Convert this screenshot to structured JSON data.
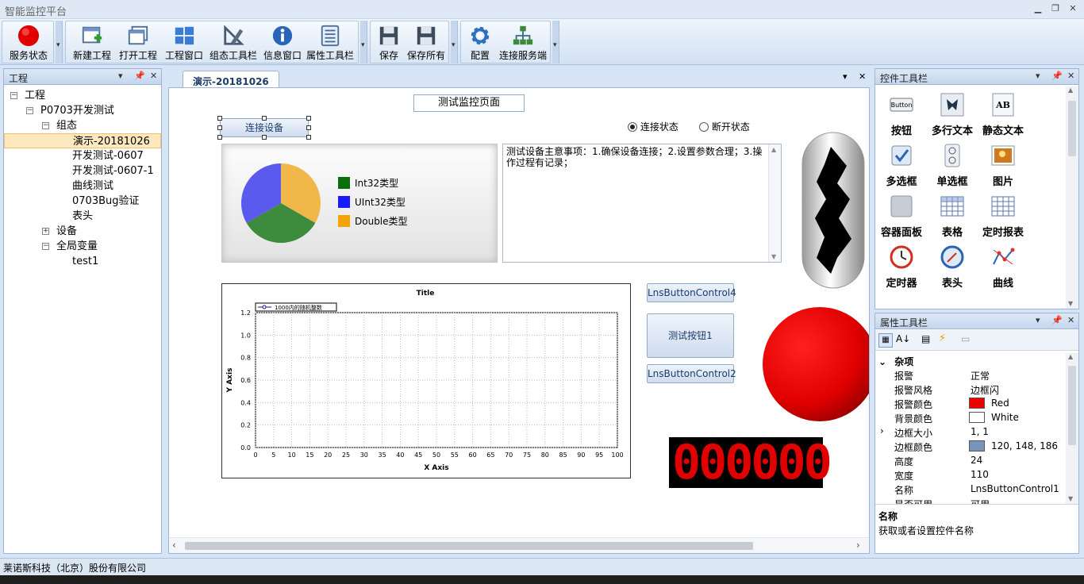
{
  "app": {
    "title": "智能监控平台"
  },
  "toolbar": {
    "g1": [
      "服务状态"
    ],
    "g2": [
      "新建工程",
      "打开工程",
      "工程窗口",
      "组态工具栏",
      "信息窗口",
      "属性工具栏"
    ],
    "g3": [
      "保存",
      "保存所有"
    ],
    "g4": [
      "配置",
      "连接服务端"
    ]
  },
  "project": {
    "title": "工程",
    "tree": [
      {
        "label": "工程",
        "level": 0,
        "tog": "−"
      },
      {
        "label": "P0703开发测试",
        "level": 1,
        "tog": "−"
      },
      {
        "label": "组态",
        "level": 2,
        "tog": "−"
      },
      {
        "label": "演示-20181026",
        "level": 3,
        "selected": true
      },
      {
        "label": "开发测试-0607",
        "level": 3
      },
      {
        "label": "开发测试-0607-1",
        "level": 3
      },
      {
        "label": "曲线测试",
        "level": 3
      },
      {
        "label": "0703Bug验证",
        "level": 3
      },
      {
        "label": "表头",
        "level": 3
      },
      {
        "label": "设备",
        "level": 2,
        "tog": "+"
      },
      {
        "label": "全局变量",
        "level": 2,
        "tog": "−"
      },
      {
        "label": "test1",
        "level": 3
      }
    ]
  },
  "doc": {
    "tab": "演示-20181026",
    "page_title": "测试监控页面",
    "connect_btn": "连接设备",
    "radio_connected": "连接状态",
    "radio_disconnected": "断开状态",
    "notes": "测试设备主意事项：1.确保设备连接；2.设置参数合理；3.操作过程有记录；",
    "pie_legend": [
      {
        "label": "Int32类型",
        "color": "#0a6e0a"
      },
      {
        "label": "UInt32类型",
        "color": "#1a1aff"
      },
      {
        "label": "Double类型",
        "color": "#f4a300"
      }
    ],
    "btn_ctrl4": "LnsButtonControl4",
    "btn_test1": "测试按钮1",
    "btn_ctrl2": "LnsButtonControl2",
    "digits": "000000"
  },
  "chart_data": {
    "type": "line",
    "title": "Title",
    "xlabel": "X Axis",
    "ylabel": "Y Axis",
    "xlim": [
      0,
      100
    ],
    "ylim": [
      0.0,
      1.2
    ],
    "xticks": [
      "0",
      "5",
      "10",
      "15",
      "20",
      "25",
      "30",
      "35",
      "40",
      "45",
      "50",
      "55",
      "60",
      "65",
      "70",
      "75",
      "80",
      "85",
      "90",
      "95",
      "100"
    ],
    "yticks": [
      "0.0",
      "0.2",
      "0.4",
      "0.6",
      "0.8",
      "1.0",
      "1.2"
    ],
    "series": [
      {
        "name": "1000内的随机整数",
        "values": []
      }
    ],
    "grid": true,
    "legend": "top-left"
  },
  "palette": {
    "title": "控件工具栏",
    "items": [
      {
        "label": "按钮",
        "icon": "button-icon"
      },
      {
        "label": "多行文本",
        "icon": "multiline-text-icon"
      },
      {
        "label": "静态文本",
        "icon": "static-text-icon"
      },
      {
        "label": "多选框",
        "icon": "checkbox-icon"
      },
      {
        "label": "单选框",
        "icon": "radio-icon"
      },
      {
        "label": "图片",
        "icon": "picture-icon"
      },
      {
        "label": "容器面板",
        "icon": "container-icon"
      },
      {
        "label": "表格",
        "icon": "table-icon"
      },
      {
        "label": "定时报表",
        "icon": "timed-report-icon"
      },
      {
        "label": "定时器",
        "icon": "timer-icon"
      },
      {
        "label": "表头",
        "icon": "gauge-icon"
      },
      {
        "label": "曲线",
        "icon": "curve-icon"
      }
    ],
    "button_icon_text": "Button",
    "static_icon_text": "AB"
  },
  "props": {
    "title": "属性工具栏",
    "category": "杂项",
    "rows": [
      {
        "k": "报警",
        "v": "正常"
      },
      {
        "k": "报警风格",
        "v": "边框闪"
      },
      {
        "k": "报警颜色",
        "v": "Red",
        "swatch": "#ee0000"
      },
      {
        "k": "背景颜色",
        "v": "White",
        "swatch": "#ffffff"
      },
      {
        "k": "边框大小",
        "v": "1, 1",
        "expand": true
      },
      {
        "k": "边框颜色",
        "v": "120, 148, 186",
        "swatch": "#7894ba"
      },
      {
        "k": "高度",
        "v": "24"
      },
      {
        "k": "宽度",
        "v": "110"
      },
      {
        "k": "名称",
        "v": "LnsButtonControl1"
      },
      {
        "k": "是否可用",
        "v": "可用"
      }
    ],
    "desc_title": "名称",
    "desc_text": "获取或者设置控件名称"
  },
  "status": {
    "company": "莱诺斯科技（北京）股份有限公司"
  }
}
